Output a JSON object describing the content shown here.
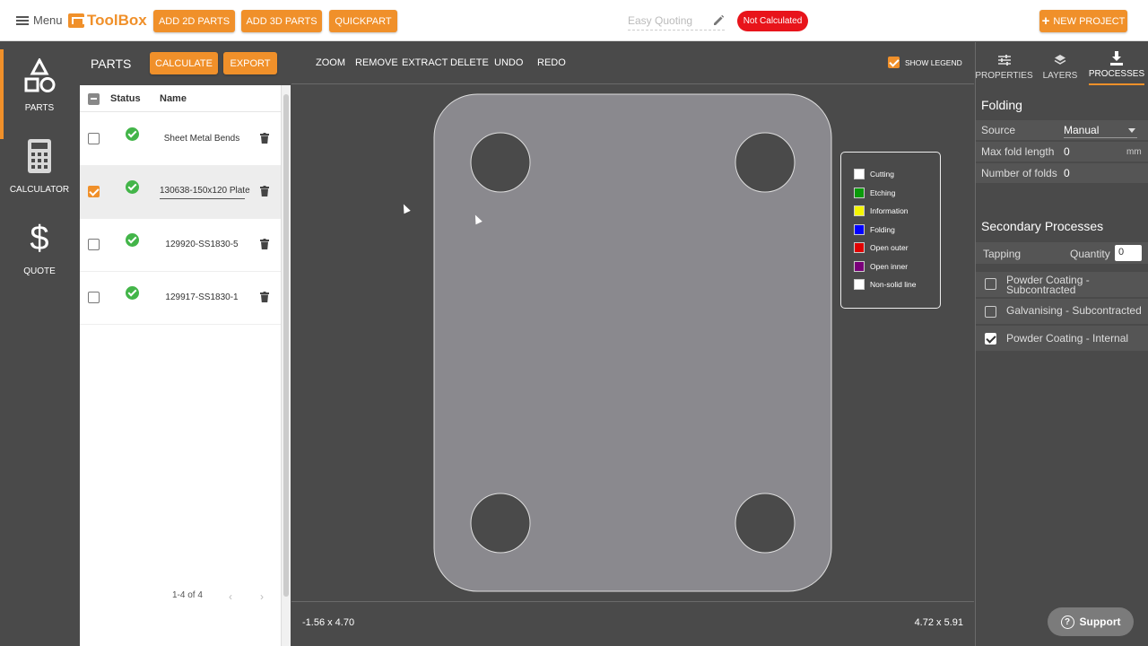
{
  "topbar": {
    "menu_label": "Menu",
    "logo_text": "ToolBox",
    "add_2d_label": "ADD 2D PARTS",
    "add_3d_label": "ADD 3D PARTS",
    "quickpart_label": "QUICKPART",
    "quote_name": "Easy Quoting",
    "status": "Not Calculated",
    "status_color": "#e8141b",
    "new_project_label": "NEW PROJECT"
  },
  "leftnav": {
    "items": [
      {
        "label": "PARTS",
        "icon": "shapes-icon",
        "active": true
      },
      {
        "label": "CALCULATOR",
        "icon": "calculator-icon",
        "active": false
      },
      {
        "label": "QUOTE",
        "icon": "dollar-icon",
        "active": false
      }
    ]
  },
  "parts": {
    "title": "PARTS",
    "calculate_label": "CALCULATE",
    "export_label": "EXPORT",
    "columns": {
      "status": "Status",
      "name": "Name"
    },
    "rows": [
      {
        "name": "Sheet Metal Bends",
        "checked": false,
        "status": "ok"
      },
      {
        "name": "130638-150x120 Plate",
        "checked": true,
        "status": "ok"
      },
      {
        "name": "129920-SS1830-5",
        "checked": false,
        "status": "ok"
      },
      {
        "name": "129917-SS1830-1",
        "checked": false,
        "status": "ok"
      }
    ],
    "pager": "1-4 of 4"
  },
  "toolbar": {
    "zoom": "ZOOM",
    "remove": "REMOVE",
    "extract": "EXTRACT",
    "delete": "DELETE",
    "undo": "UNDO",
    "redo": "REDO",
    "show_legend": "SHOW LEGEND"
  },
  "legend": [
    {
      "label": "Cutting",
      "color": "#ffffff"
    },
    {
      "label": "Etching",
      "color": "#0a9a0a"
    },
    {
      "label": "Information",
      "color": "#f5f500"
    },
    {
      "label": "Folding",
      "color": "#0000ff"
    },
    {
      "label": "Open outer",
      "color": "#e00000"
    },
    {
      "label": "Open inner",
      "color": "#7a007a"
    },
    {
      "label": "Non-solid line",
      "color": "#ffffff"
    }
  ],
  "canvas": {
    "cursor_coord": "-1.56 x 4.70",
    "part_dims": "4.72 x 5.91"
  },
  "right": {
    "tabs": [
      {
        "label": "PROPERTIES",
        "icon": "sliders-icon",
        "active": false
      },
      {
        "label": "LAYERS",
        "icon": "layers-icon",
        "active": false
      },
      {
        "label": "PROCESSES",
        "icon": "download-icon",
        "active": true
      }
    ],
    "folding": {
      "title": "Folding",
      "source_label": "Source",
      "source_value": "Manual",
      "max_fold_label": "Max fold length",
      "max_fold_value": "0",
      "max_fold_unit": "mm",
      "num_folds_label": "Number of folds",
      "num_folds_value": "0"
    },
    "secondary": {
      "title": "Secondary Processes",
      "tapping_label": "Tapping",
      "quantity_label": "Quantity",
      "quantity_value": "0",
      "items": [
        {
          "label": "Powder Coating - Subcontracted",
          "checked": false
        },
        {
          "label": "Galvanising - Subcontracted",
          "checked": false
        },
        {
          "label": "Powder Coating - Internal",
          "checked": true
        }
      ]
    }
  },
  "support_label": "Support",
  "accent_color": "#f0902a"
}
